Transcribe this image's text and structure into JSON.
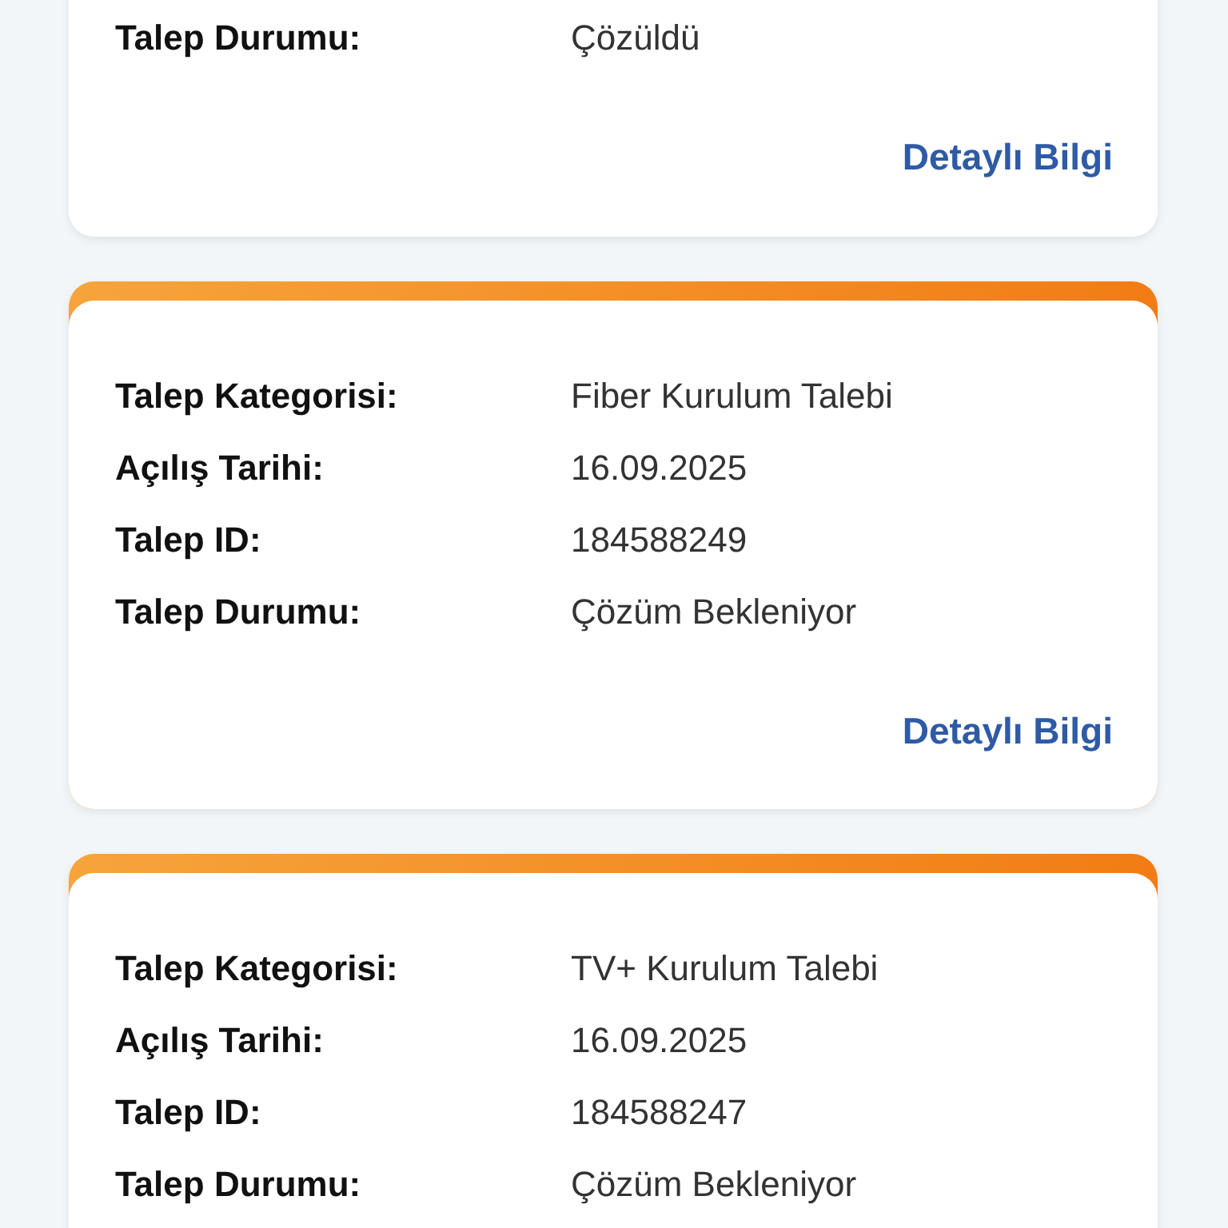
{
  "requests": [
    {
      "rows": [
        {
          "label": "Talep Durumu:",
          "value": "Çözüldü"
        }
      ],
      "link": "Detaylı Bilgi"
    },
    {
      "rows": [
        {
          "label": "Talep Kategorisi:",
          "value": "Fiber Kurulum Talebi"
        },
        {
          "label": "Açılış Tarihi:",
          "value": "16.09.2025"
        },
        {
          "label": "Talep ID:",
          "value": "184588249"
        },
        {
          "label": "Talep Durumu:",
          "value": "Çözüm Bekleniyor"
        }
      ],
      "link": "Detaylı Bilgi"
    },
    {
      "rows": [
        {
          "label": "Talep Kategorisi:",
          "value": "TV+ Kurulum Talebi"
        },
        {
          "label": "Açılış Tarihi:",
          "value": "16.09.2025"
        },
        {
          "label": "Talep ID:",
          "value": "184588247"
        },
        {
          "label": "Talep Durumu:",
          "value": "Çözüm Bekleniyor"
        }
      ]
    }
  ]
}
